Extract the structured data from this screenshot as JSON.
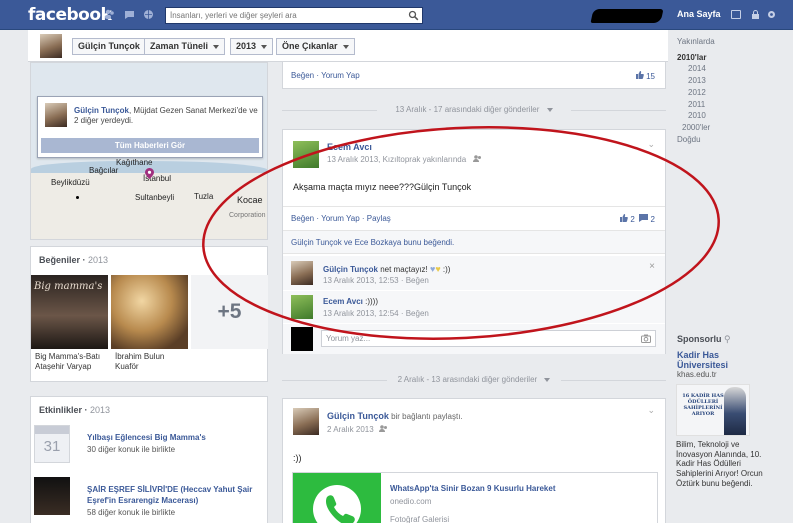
{
  "topbar": {
    "logo": "facebook",
    "search_placeholder": "İnsanları, yerleri ve diğer şeyleri ara",
    "home_label": "Ana Sayfa"
  },
  "timeline_bar": {
    "name": "Gülçin Tunçok",
    "menu": "Zaman Tüneli",
    "year": "2013",
    "highlights": "Öne Çıkanlar"
  },
  "map_card": {
    "popup_name": "Gülçin Tunçok",
    "popup_text": ", Müjdat Gezen Sanat Merkezi'de ve 2 diğer yerdeydi.",
    "popup_button": "Tüm Haberleri Gör",
    "places": [
      "Kağıthane",
      "Bağcılar",
      "İstanbul",
      "Beylikdüzü",
      "Sultanbeyli",
      "Tuzla",
      "Kocae",
      "Corporation"
    ]
  },
  "likes_card": {
    "title": "Beğeniler",
    "year": "2013",
    "tile1_text": "Big mamma's",
    "items": [
      {
        "line1": "Big Mamma's-Batı",
        "line2": "Ataşehir Varyap"
      },
      {
        "line1": "İbrahim Bulun",
        "line2": "Kuaför"
      }
    ],
    "more": "+5"
  },
  "events_card": {
    "title": "Etkinlikler",
    "year": "2013",
    "day": "31",
    "items": [
      {
        "title": "Yılbaşı Eğlencesi Big Mamma's",
        "sub": "30 diğer konuk ile birlikte"
      },
      {
        "title": "ŞAİR EŞREF SİLİVRİ'DE (Heccav Yahut Şair",
        "title2": "Eşref'in Esrarengiz Macerası)",
        "sub": "58 diğer konuk ile birlikte"
      }
    ]
  },
  "top_post_actions": {
    "actions": "Beğen · Yorum Yap",
    "likes": "15"
  },
  "divider1": "13 Aralık - 17 arasındaki diğer gönderiler",
  "post1": {
    "author": "Ecem Avcı",
    "meta": "13 Aralık 2013, Kızıltoprak yakınlarında",
    "text": "Akşama maçta mıyız neee???Gülçin Tunçok",
    "actions": "Beğen · Yorum Yap · Paylaş",
    "like_count": "2",
    "comment_count": "2",
    "liked_by": "Gülçin Tunçok ve Ece Bozkaya bunu beğendi.",
    "comments": [
      {
        "author": "Gülçin Tunçok",
        "text": " net maçtayız! ",
        "tail": " :))",
        "meta": "13 Aralık 2013, 12:53 · Beğen"
      },
      {
        "author": "Ecem Avcı",
        "text": " :))))",
        "meta": "13 Aralık 2013, 12:54 · Beğen"
      }
    ],
    "comment_placeholder": "Yorum yaz..."
  },
  "divider2": "2 Aralık - 13 arasındaki diğer gönderiler",
  "post2": {
    "author": "Gülçin Tunçok",
    "verb": " bir bağlantı paylaştı.",
    "meta": "2 Aralık 2013",
    "text": ":))",
    "link_title": "WhatsApp'ta Sinir Bozan 9 Kusurlu Hareket",
    "link_domain": "onedio.com",
    "link_sub": "Fotoğraf Galerisi"
  },
  "year_nav": {
    "recent": "Yakınlarda",
    "selected": "2010'lar",
    "years": [
      "2014",
      "2013",
      "2012",
      "2011",
      "2010"
    ],
    "older": "2000'ler",
    "born": "Doğdu"
  },
  "sponsor": {
    "title": "Sponsorlu",
    "ad_title": "Kadir Has Üniversitesi",
    "ad_url": "khas.edu.tr",
    "ad_image_text": "16 KADİR HAS ÖDÜLLERİ SAHİPLERİNİ ARIYOR",
    "ad_desc": "Bilim, Teknoloji ve İnovasyon Alanında, 10. Kadir Has Ödülleri Sahiplerini Arıyor! Orcun Öztürk bunu beğendi."
  },
  "colors": {
    "brand": "#3b5998",
    "annotation": "#c0141c"
  }
}
